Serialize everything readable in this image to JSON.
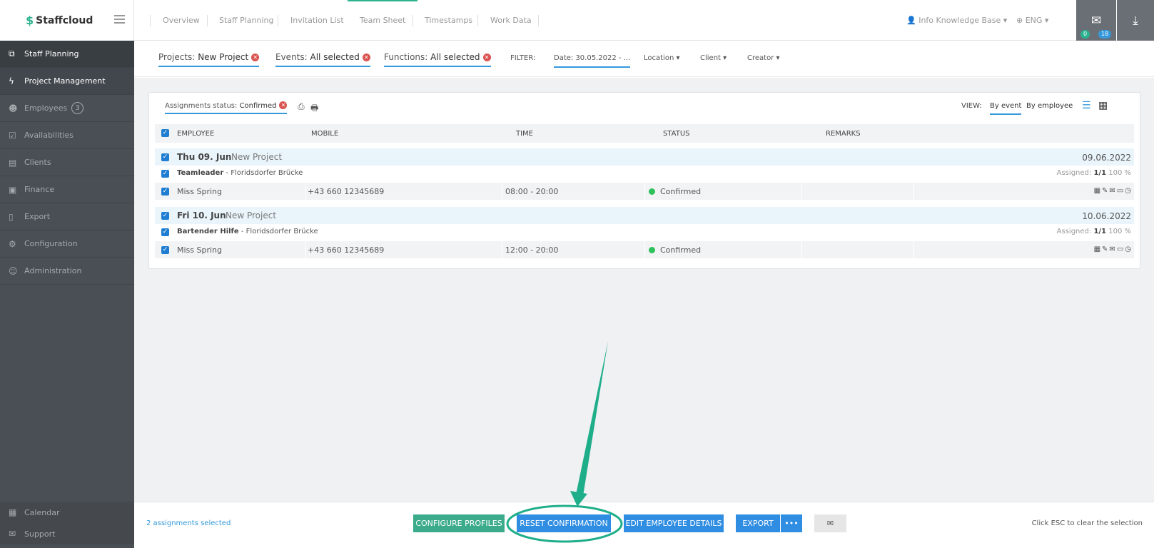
{
  "brand": {
    "name": "Staffcloud"
  },
  "sidebar": {
    "items": [
      {
        "label": "Staff Planning"
      },
      {
        "label": "Project Management"
      },
      {
        "label": "Employees",
        "badge": "3"
      },
      {
        "label": "Availabilities"
      },
      {
        "label": "Clients"
      },
      {
        "label": "Finance"
      },
      {
        "label": "Export"
      },
      {
        "label": "Configuration"
      },
      {
        "label": "Administration"
      }
    ],
    "bottom": [
      {
        "label": "Calendar"
      },
      {
        "label": "Support"
      }
    ]
  },
  "topnav": {
    "tabs": [
      "Overview",
      "Staff Planning",
      "Invitation List",
      "Team Sheet",
      "Timestamps",
      "Work Data"
    ],
    "active": "Team Sheet",
    "user": "Info Knowledge Base",
    "lang": "ENG",
    "mail_green": "0",
    "mail_blue": "18"
  },
  "filters": {
    "projects_label": "Projects:",
    "projects_value": "New Project",
    "events_label": "Events:",
    "events_value": "All selected",
    "functions_label": "Functions:",
    "functions_value": "All selected",
    "filter_label": "FILTER:",
    "date": "Date: 30.05.2022 - ...",
    "location": "Location",
    "client": "Client",
    "creator": "Creator"
  },
  "panel": {
    "status_label": "Assignments status:",
    "status_value": "Confirmed",
    "view_label": "VIEW:",
    "by_event": "By event",
    "by_employee": "By employee",
    "columns": [
      "EMPLOYEE",
      "MOBILE",
      "TIME",
      "STATUS",
      "REMARKS"
    ],
    "groups": [
      {
        "day": "Thu 09. Jun",
        "project": "New Project",
        "date": "09.06.2022",
        "function": "Teamleader",
        "location": "- Floridsdorfer Brücke",
        "assigned_label": "Assigned:",
        "assigned": "1/1",
        "pct": "100 %",
        "row": {
          "name": "Miss Spring",
          "mobile": "+43 660 12345689",
          "time": "08:00 - 20:00",
          "status": "Confirmed"
        }
      },
      {
        "day": "Fri 10. Jun",
        "project": "New Project",
        "date": "10.06.2022",
        "function": "Bartender Hilfe",
        "location": "- Floridsdorfer Brücke",
        "assigned_label": "Assigned:",
        "assigned": "1/1",
        "pct": "100 %",
        "row": {
          "name": "Miss Spring",
          "mobile": "+43 660 12345689",
          "time": "12:00 - 20:00",
          "status": "Confirmed"
        }
      }
    ]
  },
  "footer": {
    "selected": "2 assignments selected",
    "configure": "CONFIGURE PROFILES",
    "reset": "RESET CONFIRMATION",
    "edit": "EDIT EMPLOYEE DETAILS",
    "export": "EXPORT",
    "more": "•••",
    "hint": "Click ESC to clear the selection"
  },
  "colors": {
    "accent": "#2ab38f",
    "primary": "#3498db",
    "annotation": "#1fae8a"
  }
}
